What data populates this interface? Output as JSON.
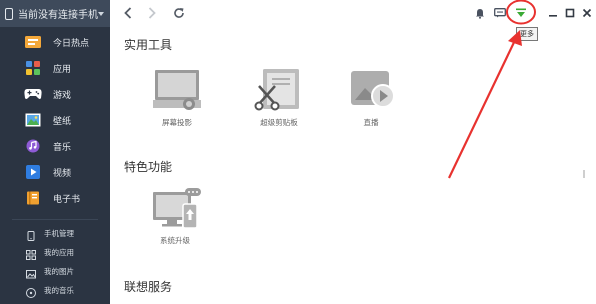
{
  "sidebar": {
    "device_label": "当前没有连接手机",
    "items": [
      {
        "label": "今日热点",
        "icon": "hot-news-icon"
      },
      {
        "label": "应用",
        "icon": "apps-icon"
      },
      {
        "label": "游戏",
        "icon": "gamepad-icon"
      },
      {
        "label": "壁纸",
        "icon": "wallpaper-icon"
      },
      {
        "label": "音乐",
        "icon": "music-icon"
      },
      {
        "label": "视频",
        "icon": "video-icon"
      },
      {
        "label": "电子书",
        "icon": "ebook-icon"
      }
    ],
    "sub_items": [
      {
        "label": "手机管理",
        "icon": "phone-manage-icon"
      },
      {
        "label": "我的应用",
        "icon": "my-apps-icon"
      },
      {
        "label": "我的图片",
        "icon": "my-pictures-icon"
      },
      {
        "label": "我的音乐",
        "icon": "my-music-icon"
      }
    ]
  },
  "topbar": {
    "tooltip": "更多",
    "icons": [
      "back-icon",
      "forward-icon",
      "refresh-icon",
      "notification-bell-icon",
      "message-icon",
      "more-menu-icon",
      "minimize-icon",
      "maximize-icon",
      "close-icon"
    ]
  },
  "main": {
    "sections": [
      {
        "title": "实用工具"
      },
      {
        "title": "特色功能"
      },
      {
        "title": "联想服务"
      }
    ],
    "tools": [
      {
        "label": "屏幕投影"
      },
      {
        "label": "超级剪贴板"
      },
      {
        "label": "直播"
      }
    ],
    "features": [
      {
        "label": "系统升级"
      }
    ]
  },
  "colors": {
    "sidebar_bg": "#2b3442",
    "device_bar_bg": "#3e4a5b",
    "annotation_red": "#e8322f",
    "more_icon_green": "#3aaa35"
  }
}
